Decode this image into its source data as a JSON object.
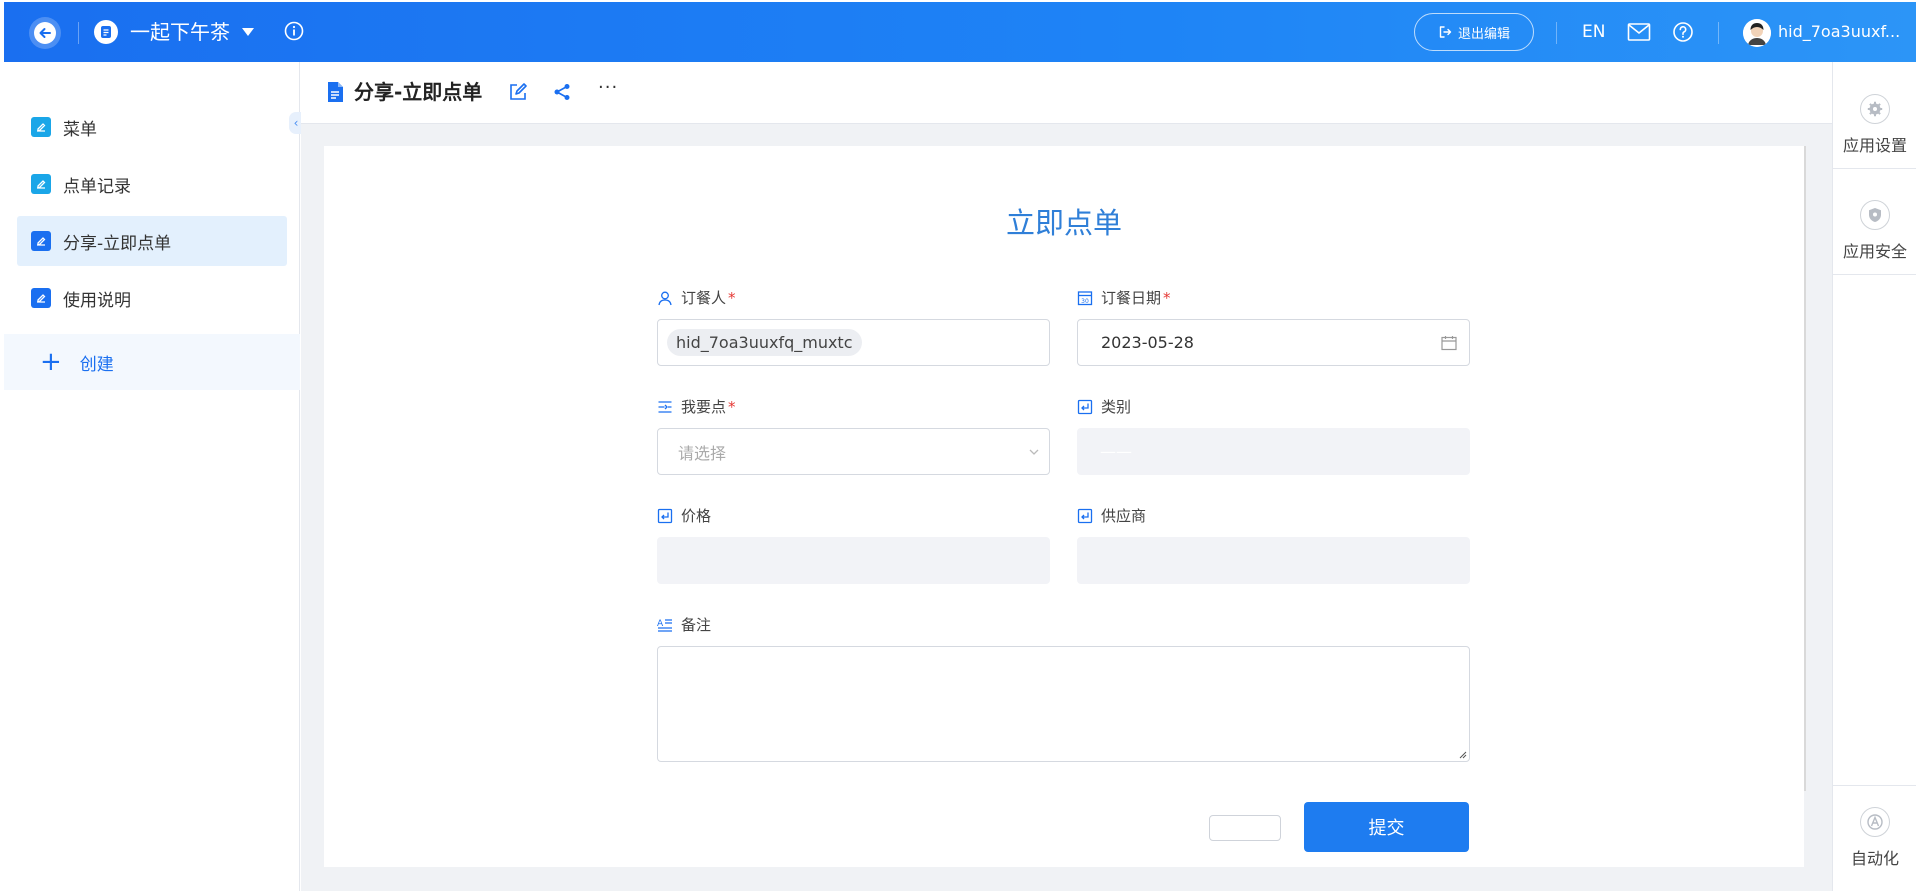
{
  "header": {
    "app_title": "一起下午茶",
    "exit_edit_label": "退出编辑",
    "lang_label": "EN",
    "username": "hid_7oa3uuxf..."
  },
  "sidebar": {
    "items": [
      {
        "label": "菜单",
        "color": "#1aa6e8"
      },
      {
        "label": "点单记录",
        "color": "#1aa6e8"
      },
      {
        "label": "分享-立即点单",
        "color": "#1a6ff0"
      },
      {
        "label": "使用说明",
        "color": "#1a6ff0"
      }
    ],
    "create_label": "创建"
  },
  "page": {
    "title": "分享-立即点单"
  },
  "form": {
    "title": "立即点单",
    "orderer_label": "订餐人",
    "orderer_value": "hid_7oa3uuxfq_muxtc",
    "date_label": "订餐日期",
    "date_value": "2023-05-28",
    "item_label": "我要点",
    "item_placeholder": "请选择",
    "category_label": "类别",
    "category_value": "——",
    "price_label": "价格",
    "supplier_label": "供应商",
    "notes_label": "备注",
    "submit_label": "提交",
    "required_mark": "*"
  },
  "right_panel": {
    "app_settings_label": "应用设置",
    "app_security_label": "应用安全",
    "automation_label": "自动化"
  },
  "colors": {
    "brand": "#1a6ff0",
    "title_blue": "#2f7fd8",
    "required": "#e53935"
  }
}
